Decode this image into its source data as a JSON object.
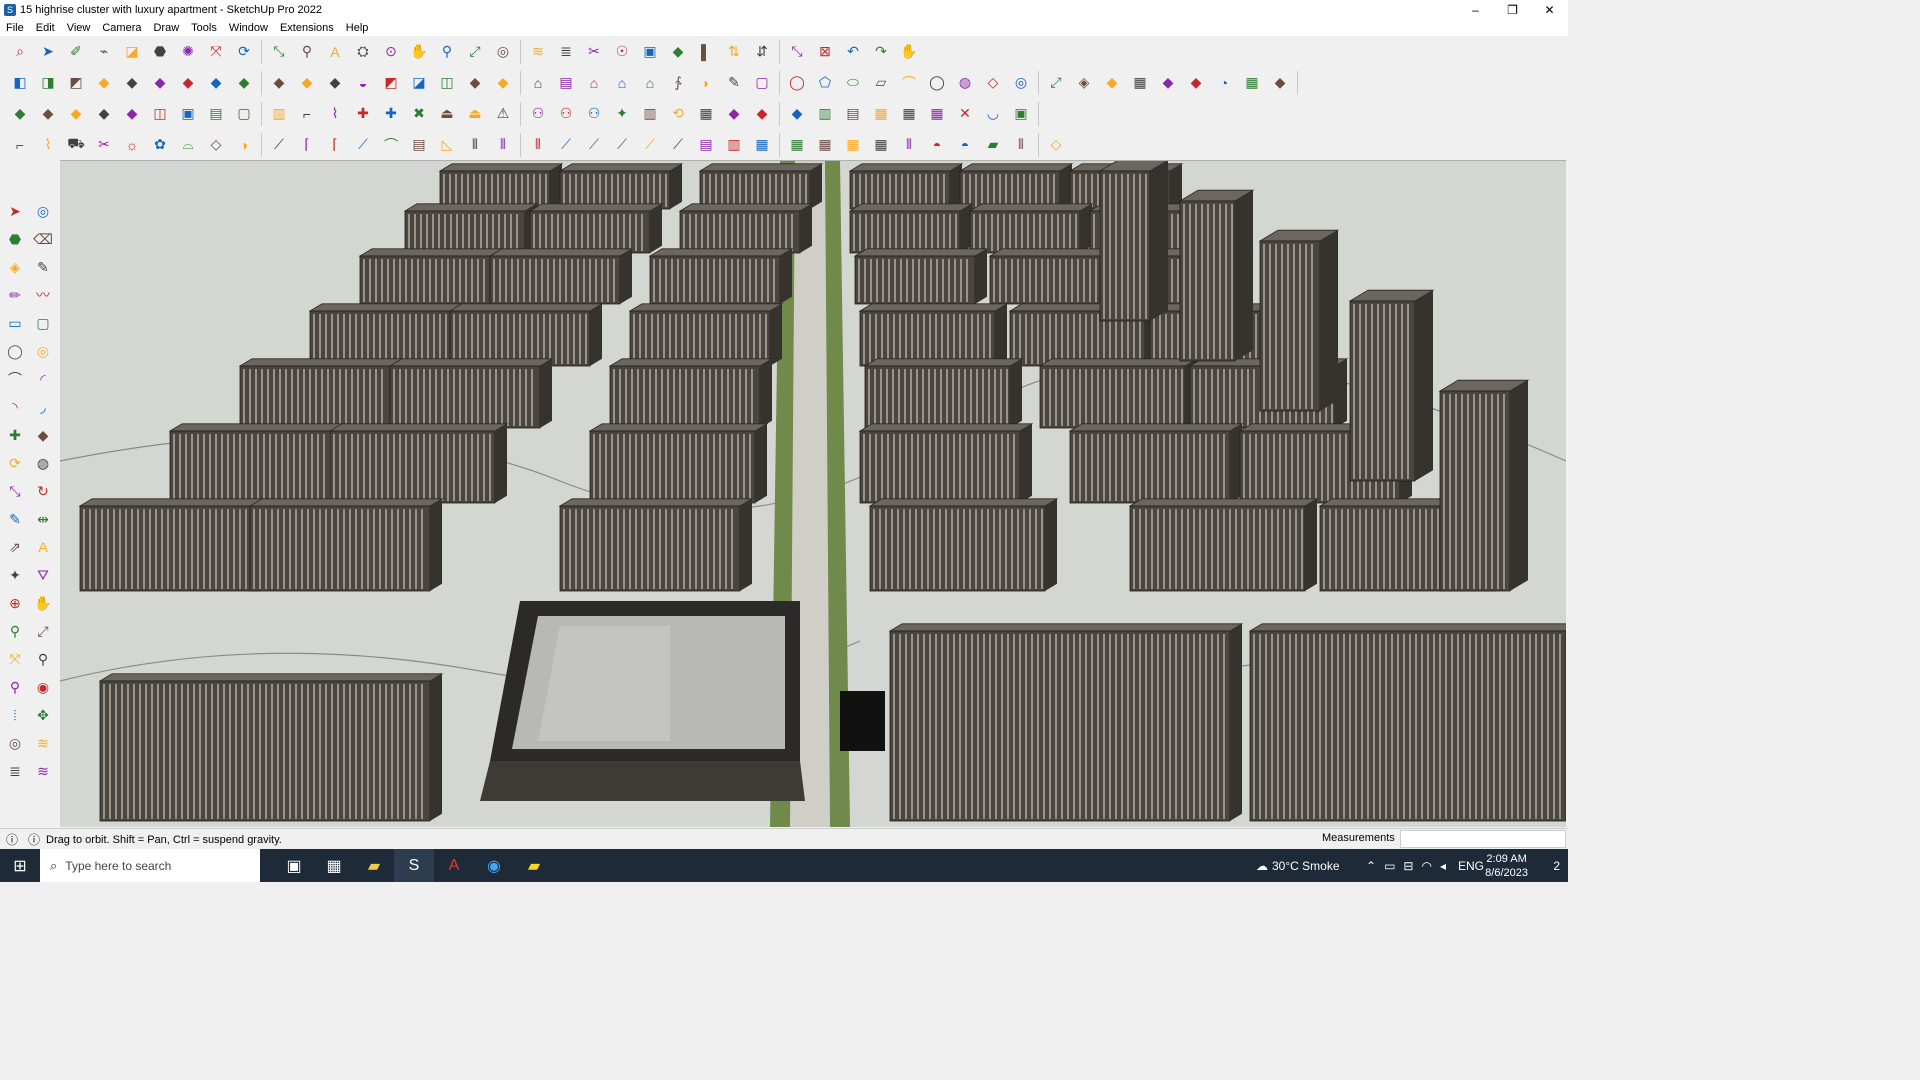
{
  "window": {
    "title": "15 highrise cluster with luxury apartment - SketchUp Pro 2022",
    "minimize": "–",
    "restore": "❐",
    "close": "✕"
  },
  "menu": [
    "File",
    "Edit",
    "View",
    "Camera",
    "Draw",
    "Tools",
    "Window",
    "Extensions",
    "Help"
  ],
  "toolbar_rows": [
    [
      "⌕",
      "➤",
      "✐",
      "⌁",
      "◪",
      "⬣",
      "✺",
      "⤧",
      "⟳",
      "⤡",
      "⚲",
      "A",
      "⛭",
      "⊙",
      "✋",
      "⚲",
      "⤢",
      "◎",
      "≋",
      "≣",
      "✂",
      "☉",
      "▣",
      "◆",
      "▌",
      "⇅",
      "⇵",
      "⤡",
      "⊠",
      "↶",
      "↷",
      "✋"
    ],
    [
      "◧",
      "◨",
      "◩",
      "◆",
      "◆",
      "◆",
      "◆",
      "◆",
      "◆",
      "◆",
      "◆",
      "◆",
      "◒",
      "◩",
      "◪",
      "◫",
      "◆",
      "◆",
      "⌂",
      "▤",
      "⌂",
      "⌂",
      "⌂",
      "∱",
      "◗",
      "✎",
      "▢",
      "◯",
      "⬠",
      "⬭",
      "▱",
      "⌒",
      "◯",
      "◍",
      "◇",
      "◎",
      "⤢",
      "◈",
      "◆",
      "▦",
      "◆",
      "◆",
      "◔",
      "▦",
      "◆"
    ],
    [
      "◆",
      "◆",
      "◆",
      "◆",
      "◆",
      "◫",
      "▣",
      "▤",
      "▢",
      "▥",
      "⌐",
      "⌇",
      "✚",
      "✚",
      "✖",
      "⏏",
      "⏏",
      "⚠",
      "⚇",
      "⚇",
      "⚇",
      "✦",
      "▥",
      "⟲",
      "▦",
      "◆",
      "◆",
      "◆",
      "▥",
      "▤",
      "▦",
      "▦",
      "▦",
      "✕",
      "◡",
      "▣"
    ],
    [
      "⌐",
      "⌇",
      "⛟",
      "✂",
      "☼",
      "✿",
      "⌓",
      "◇",
      "◑",
      "⟋",
      "⌈",
      "⌈",
      "⟋",
      "⌒",
      "▤",
      "◺",
      "⦀",
      "⦀",
      "⦀",
      "⟋",
      "⟋",
      "⟋",
      "⟋",
      "⟋",
      "▤",
      "▥",
      "▦",
      "▦",
      "▦",
      "▦",
      "▦",
      "⦀",
      "◓",
      "◓",
      "▰",
      "⦀",
      "◇"
    ]
  ],
  "left_toolbar": [
    "➤",
    "◎",
    "⬣",
    "⌫",
    "◈",
    "✎",
    "✏",
    "〰",
    "▭",
    "▢",
    "◯",
    "◎",
    "⌒",
    "◜",
    "◝",
    "◞",
    "✚",
    "◆",
    "⟳",
    "◍",
    "⤡",
    "↻",
    "✎",
    "⇹",
    "⇗",
    "A",
    "✦",
    "⛛",
    "⊕",
    "✋",
    "⚲",
    "⤢",
    "⤧",
    "⚲",
    "⚲",
    "◉",
    "⦙",
    "✥",
    "◎",
    "≋",
    "≣",
    "≋"
  ],
  "viewport": {
    "sky": "#d8dad5",
    "ground": "#c9ccc6"
  },
  "status": {
    "text": "Drag to orbit. Shift = Pan, Ctrl = suspend gravity.",
    "measurements_label": "Measurements"
  },
  "taskbar": {
    "search_placeholder": "Type here to search",
    "weather": "30°C  Smoke",
    "language": "ENG",
    "time": "2:09 AM",
    "date": "8/6/2023",
    "notifications": "2"
  }
}
